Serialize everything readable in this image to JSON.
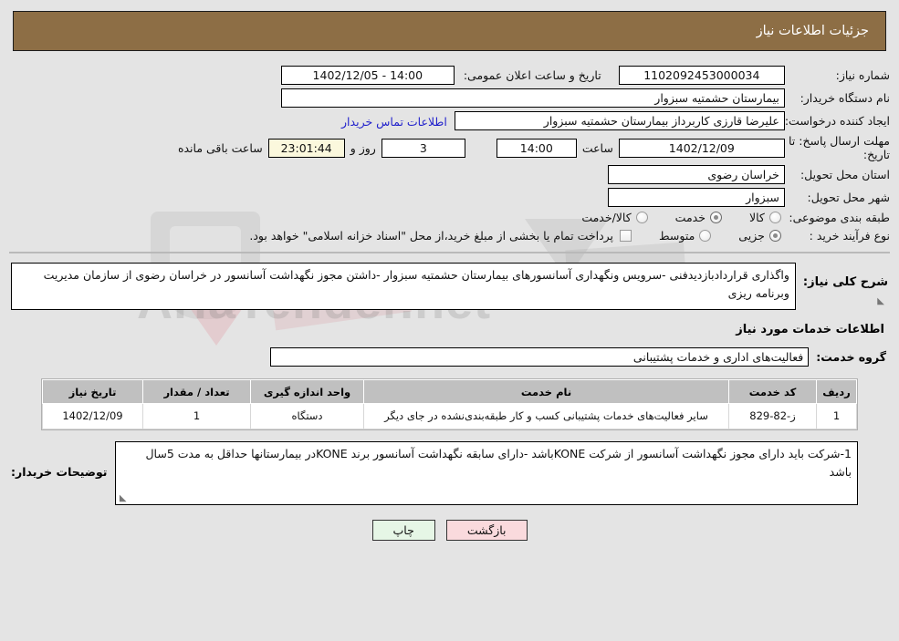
{
  "header": {
    "title": "جزئیات اطلاعات نیاز"
  },
  "fields": {
    "need_number_label": "شماره نیاز:",
    "need_number_value": "1102092453000034",
    "announce_label": "تاریخ و ساعت اعلان عمومی:",
    "announce_value": "14:00 - 1402/12/05",
    "buyer_org_label": "نام دستگاه خریدار:",
    "buyer_org_value": "بیمارستان حشمتیه سبزوار",
    "requester_label": "ایجاد کننده درخواست:",
    "requester_value": "علیرضا قارزی کاربرداز بیمارستان حشمتیه سبزوار",
    "contact_link": "اطلاعات تماس خریدار",
    "deadline_label_line1": "مهلت ارسال پاسخ: تا",
    "deadline_label_line2": "تاریخ:",
    "deadline_date": "1402/12/09",
    "hour_label": "ساعت",
    "hour_value": "14:00",
    "days_value": "3",
    "days_label": "روز و",
    "countdown_value": "23:01:44",
    "countdown_label": "ساعت باقی مانده",
    "province_label": "استان محل تحویل:",
    "province_value": "خراسان رضوی",
    "city_label": "شهر محل تحویل:",
    "city_value": "سبزوار",
    "category_label": "طبقه بندی موضوعی:",
    "process_label": "نوع فرآیند خرید :",
    "treasury_note": "پرداخت تمام یا بخشی از مبلغ خرید،از محل \"اسناد خزانه اسلامی\" خواهد بود."
  },
  "category_options": [
    {
      "label": "کالا",
      "selected": false
    },
    {
      "label": "خدمت",
      "selected": true
    },
    {
      "label": "کالا/خدمت",
      "selected": false
    }
  ],
  "process_options": [
    {
      "label": "جزیی",
      "selected": true
    },
    {
      "label": "متوسط",
      "selected": false
    }
  ],
  "treasury_checkbox": {
    "checked": false
  },
  "description": {
    "label": "شرح کلی نیاز:",
    "value": "واگذاری قراردادبازدیدفنی -سرویس ونگهداری آسانسورهای بیمارستان حشمتیه سبزوار -داشتن مجوز نگهداشت آسانسور در خراسان رضوی از سازمان مدیریت وبرنامه ریزی"
  },
  "services_section": {
    "heading": "اطلاعات خدمات مورد نیاز",
    "group_label": "گروه خدمت:",
    "group_value": "فعالیت‌های اداری و خدمات پشتیبانی"
  },
  "items_table": {
    "columns": [
      "ردیف",
      "کد خدمت",
      "نام خدمت",
      "واحد اندازه گیری",
      "تعداد / مقدار",
      "تاریخ نیاز"
    ],
    "rows": [
      {
        "row": "1",
        "code": "ز-82-829",
        "name": "سایر فعالیت‌های خدمات پشتیبانی کسب و کار طبقه‌بندی‌نشده در جای دیگر",
        "unit": "دستگاه",
        "quantity": "1",
        "date": "1402/12/09"
      }
    ]
  },
  "buyer_notes": {
    "label": "توضیحات خریدار:",
    "value": "1-شرکت باید دارای مجوز نگهداشت آسانسور از شرکت KONEباشد -دارای سابقه نگهداشت آسانسور برند KONEدر بیمارستانها حداقل به مدت 5سال باشد"
  },
  "buttons": {
    "print": "چاپ",
    "back": "بازگشت"
  },
  "watermark": {
    "text": "AriaTender.net"
  },
  "colors": {
    "header_brown": "#8d6e45",
    "page_bg": "#e4e4e4",
    "link_blue": "#2222cc",
    "countdown_bg": "#fbf8dd",
    "print_btn": "#e6f6e6",
    "back_btn": "#fadadd",
    "table_header": "#c0c0c0"
  }
}
